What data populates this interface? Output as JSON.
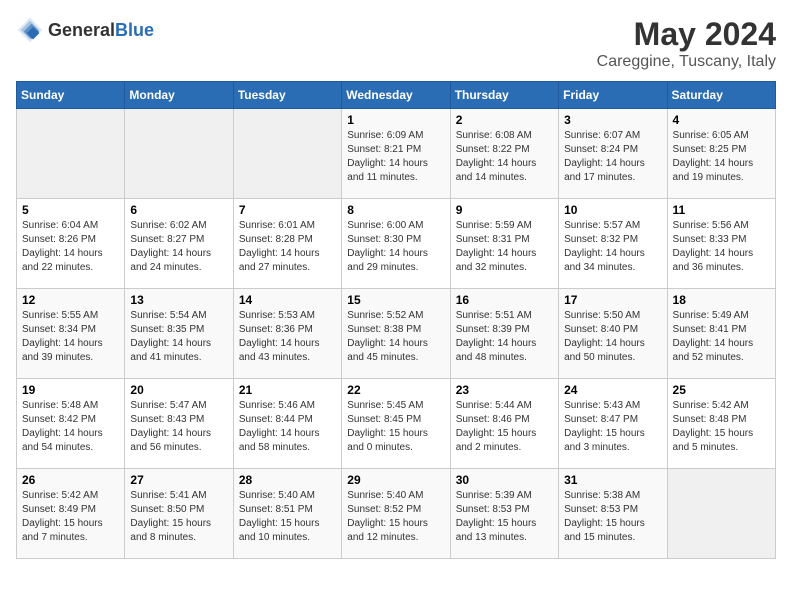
{
  "header": {
    "logo_general": "General",
    "logo_blue": "Blue",
    "month": "May 2024",
    "location": "Careggine, Tuscany, Italy"
  },
  "weekdays": [
    "Sunday",
    "Monday",
    "Tuesday",
    "Wednesday",
    "Thursday",
    "Friday",
    "Saturday"
  ],
  "weeks": [
    [
      {
        "day": "",
        "info": ""
      },
      {
        "day": "",
        "info": ""
      },
      {
        "day": "",
        "info": ""
      },
      {
        "day": "1",
        "info": "Sunrise: 6:09 AM\nSunset: 8:21 PM\nDaylight: 14 hours and 11 minutes."
      },
      {
        "day": "2",
        "info": "Sunrise: 6:08 AM\nSunset: 8:22 PM\nDaylight: 14 hours and 14 minutes."
      },
      {
        "day": "3",
        "info": "Sunrise: 6:07 AM\nSunset: 8:24 PM\nDaylight: 14 hours and 17 minutes."
      },
      {
        "day": "4",
        "info": "Sunrise: 6:05 AM\nSunset: 8:25 PM\nDaylight: 14 hours and 19 minutes."
      }
    ],
    [
      {
        "day": "5",
        "info": "Sunrise: 6:04 AM\nSunset: 8:26 PM\nDaylight: 14 hours and 22 minutes."
      },
      {
        "day": "6",
        "info": "Sunrise: 6:02 AM\nSunset: 8:27 PM\nDaylight: 14 hours and 24 minutes."
      },
      {
        "day": "7",
        "info": "Sunrise: 6:01 AM\nSunset: 8:28 PM\nDaylight: 14 hours and 27 minutes."
      },
      {
        "day": "8",
        "info": "Sunrise: 6:00 AM\nSunset: 8:30 PM\nDaylight: 14 hours and 29 minutes."
      },
      {
        "day": "9",
        "info": "Sunrise: 5:59 AM\nSunset: 8:31 PM\nDaylight: 14 hours and 32 minutes."
      },
      {
        "day": "10",
        "info": "Sunrise: 5:57 AM\nSunset: 8:32 PM\nDaylight: 14 hours and 34 minutes."
      },
      {
        "day": "11",
        "info": "Sunrise: 5:56 AM\nSunset: 8:33 PM\nDaylight: 14 hours and 36 minutes."
      }
    ],
    [
      {
        "day": "12",
        "info": "Sunrise: 5:55 AM\nSunset: 8:34 PM\nDaylight: 14 hours and 39 minutes."
      },
      {
        "day": "13",
        "info": "Sunrise: 5:54 AM\nSunset: 8:35 PM\nDaylight: 14 hours and 41 minutes."
      },
      {
        "day": "14",
        "info": "Sunrise: 5:53 AM\nSunset: 8:36 PM\nDaylight: 14 hours and 43 minutes."
      },
      {
        "day": "15",
        "info": "Sunrise: 5:52 AM\nSunset: 8:38 PM\nDaylight: 14 hours and 45 minutes."
      },
      {
        "day": "16",
        "info": "Sunrise: 5:51 AM\nSunset: 8:39 PM\nDaylight: 14 hours and 48 minutes."
      },
      {
        "day": "17",
        "info": "Sunrise: 5:50 AM\nSunset: 8:40 PM\nDaylight: 14 hours and 50 minutes."
      },
      {
        "day": "18",
        "info": "Sunrise: 5:49 AM\nSunset: 8:41 PM\nDaylight: 14 hours and 52 minutes."
      }
    ],
    [
      {
        "day": "19",
        "info": "Sunrise: 5:48 AM\nSunset: 8:42 PM\nDaylight: 14 hours and 54 minutes."
      },
      {
        "day": "20",
        "info": "Sunrise: 5:47 AM\nSunset: 8:43 PM\nDaylight: 14 hours and 56 minutes."
      },
      {
        "day": "21",
        "info": "Sunrise: 5:46 AM\nSunset: 8:44 PM\nDaylight: 14 hours and 58 minutes."
      },
      {
        "day": "22",
        "info": "Sunrise: 5:45 AM\nSunset: 8:45 PM\nDaylight: 15 hours and 0 minutes."
      },
      {
        "day": "23",
        "info": "Sunrise: 5:44 AM\nSunset: 8:46 PM\nDaylight: 15 hours and 2 minutes."
      },
      {
        "day": "24",
        "info": "Sunrise: 5:43 AM\nSunset: 8:47 PM\nDaylight: 15 hours and 3 minutes."
      },
      {
        "day": "25",
        "info": "Sunrise: 5:42 AM\nSunset: 8:48 PM\nDaylight: 15 hours and 5 minutes."
      }
    ],
    [
      {
        "day": "26",
        "info": "Sunrise: 5:42 AM\nSunset: 8:49 PM\nDaylight: 15 hours and 7 minutes."
      },
      {
        "day": "27",
        "info": "Sunrise: 5:41 AM\nSunset: 8:50 PM\nDaylight: 15 hours and 8 minutes."
      },
      {
        "day": "28",
        "info": "Sunrise: 5:40 AM\nSunset: 8:51 PM\nDaylight: 15 hours and 10 minutes."
      },
      {
        "day": "29",
        "info": "Sunrise: 5:40 AM\nSunset: 8:52 PM\nDaylight: 15 hours and 12 minutes."
      },
      {
        "day": "30",
        "info": "Sunrise: 5:39 AM\nSunset: 8:53 PM\nDaylight: 15 hours and 13 minutes."
      },
      {
        "day": "31",
        "info": "Sunrise: 5:38 AM\nSunset: 8:53 PM\nDaylight: 15 hours and 15 minutes."
      },
      {
        "day": "",
        "info": ""
      }
    ]
  ]
}
